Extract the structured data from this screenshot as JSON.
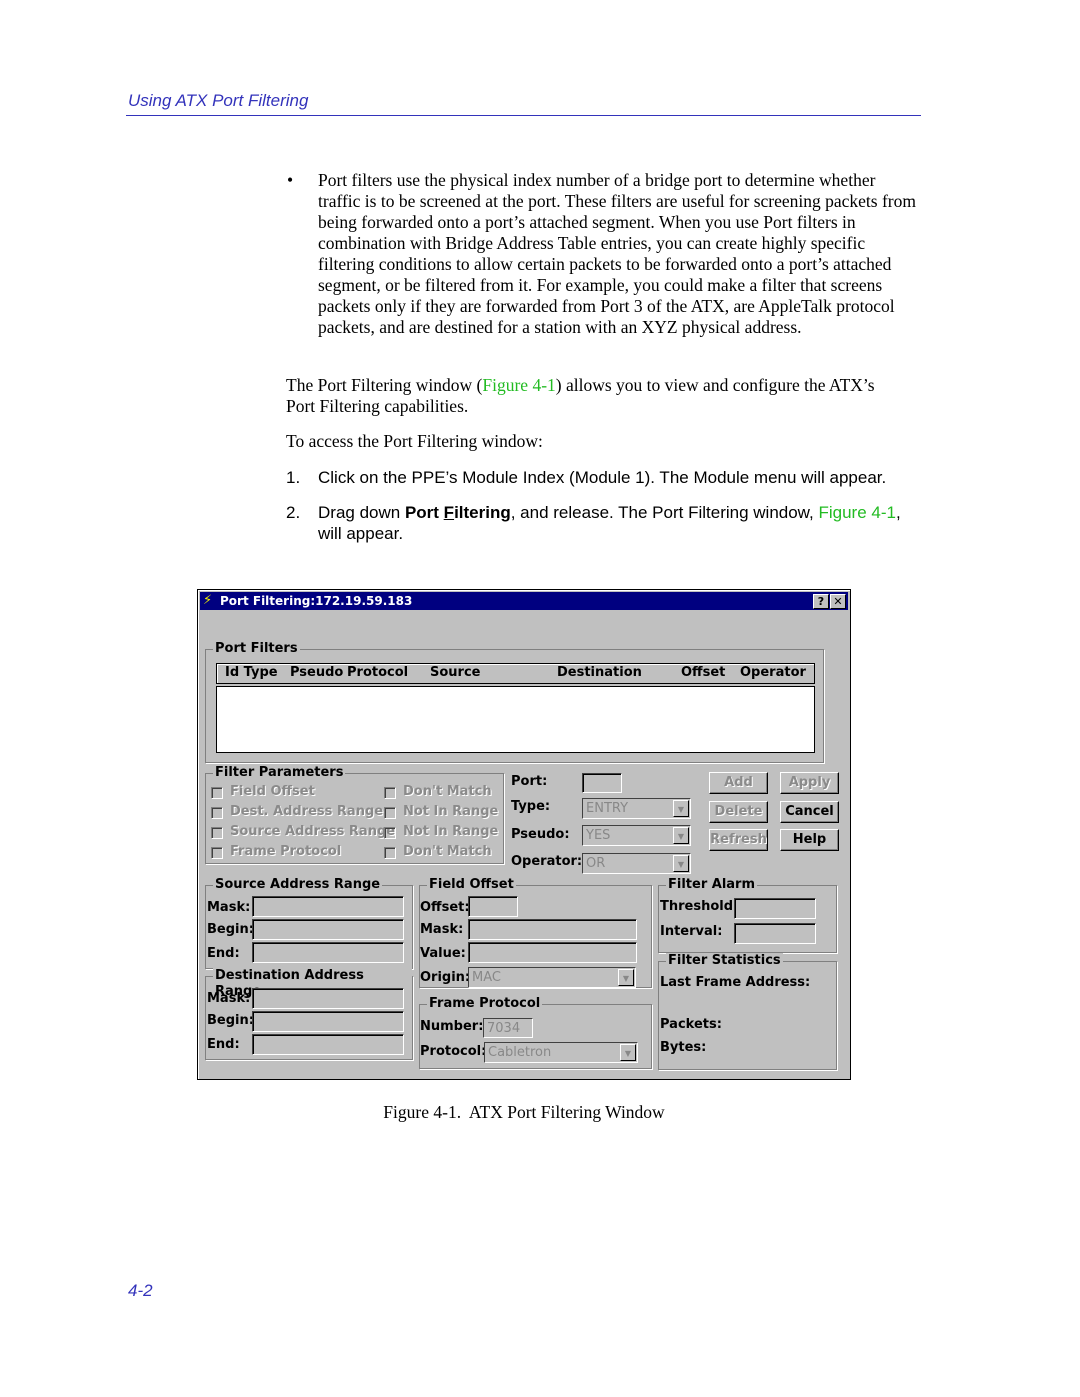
{
  "header": {
    "title": "Using ATX Port Filtering"
  },
  "body": {
    "bullet": "Port filters use the physical index number of a bridge port to determine whether traffic is to be screened at the port. These filters are useful for screening packets from being forwarded onto a port’s attached segment. When you use Port filters in combination with Bridge Address Table entries, you can create highly specific filtering conditions to allow certain packets to be forwarded onto a port’s attached segment, or be filtered from it. For example, you could make a filter that screens packets only if they are forwarded from Port 3 of the ATX, are AppleTalk protocol packets, and are destined for a station with an XYZ physical address.",
    "p1_a": "The Port Filtering window (",
    "p1_link": "Figure 4-1",
    "p1_b": ") allows you to view and configure the ATX’s Port Filtering capabilities.",
    "p2": "To access the Port Filtering window:",
    "step1_num": "1.",
    "step1": "Click on the PPE’s Module Index (Module 1). The Module menu will appear.",
    "step2_num": "2.",
    "step2_a": "Drag down ",
    "step2_bold1": "Port ",
    "step2_bold2u": "F",
    "step2_bold2": "iltering",
    "step2_b": ", and release. The Port Filtering window, ",
    "step2_link": "Figure 4-1",
    "step2_c": ", will appear."
  },
  "window": {
    "title": "Port Filtering:172.19.59.183",
    "help_btn": "?",
    "close_btn": "✕",
    "port_filters": {
      "label": "Port Filters",
      "columns": [
        "Id Type",
        "Pseudo",
        "Protocol",
        "Source",
        "Destination",
        "Offset",
        "Operator"
      ]
    },
    "filter_parameters": {
      "label": "Filter Parameters",
      "left": [
        "Field Offset",
        "Dest. Address Range",
        "Source Address Range",
        "Frame Protocol"
      ],
      "right": [
        "Don't Match",
        "Not In Range",
        "Not In Range",
        "Don't Match"
      ]
    },
    "port_label": "Port:",
    "type_label": "Type:",
    "type_value": "ENTRY",
    "pseudo_label": "Pseudo:",
    "pseudo_value": "YES",
    "operator_label": "Operator:",
    "operator_value": "OR",
    "buttons": {
      "add": "Add",
      "apply": "Apply",
      "delete": "Delete",
      "cancel": "Cancel",
      "refresh": "Refresh",
      "help": "Help"
    },
    "source_range": {
      "label": "Source Address Range",
      "mask": "Mask:",
      "begin": "Begin:",
      "end": "End:"
    },
    "dest_range": {
      "label": "Destination Address Range",
      "mask": "Mask:",
      "begin": "Begin:",
      "end": "End:"
    },
    "field_offset": {
      "label": "Field Offset",
      "offset": "Offset:",
      "mask": "Mask:",
      "value": "Value:",
      "origin": "Origin:",
      "origin_value": "MAC"
    },
    "frame_protocol": {
      "label": "Frame Protocol",
      "number": "Number:",
      "number_value": "7034",
      "protocol": "Protocol:",
      "protocol_value": "Cabletron"
    },
    "filter_alarm": {
      "label": "Filter Alarm",
      "threshold": "Threshold",
      "interval": "Interval:"
    },
    "filter_stats": {
      "label": "Filter Statistics",
      "last_frame": "Last Frame Address:",
      "packets": "Packets:",
      "bytes": "Bytes:"
    }
  },
  "caption": "Figure 4-1.  ATX Port Filtering Window",
  "page_number": "4-2",
  "colors": {
    "header": "#3333bb",
    "link": "#22bb22",
    "titlebar": "#000080",
    "window_bg": "#c0c0c0"
  }
}
